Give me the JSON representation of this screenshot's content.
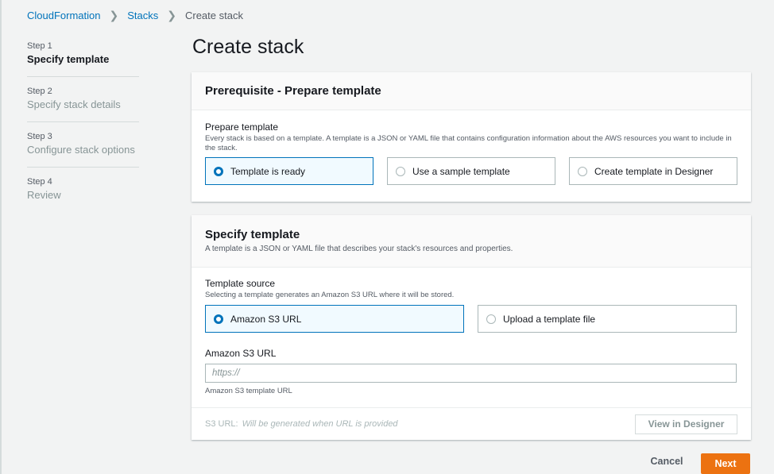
{
  "breadcrumb": {
    "items": [
      "CloudFormation",
      "Stacks"
    ],
    "current": "Create stack"
  },
  "steps": [
    {
      "num": "Step 1",
      "title": "Specify template"
    },
    {
      "num": "Step 2",
      "title": "Specify stack details"
    },
    {
      "num": "Step 3",
      "title": "Configure stack options"
    },
    {
      "num": "Step 4",
      "title": "Review"
    }
  ],
  "page_title": "Create stack",
  "prerequisite": {
    "title": "Prerequisite - Prepare template",
    "field_label": "Prepare template",
    "field_desc": "Every stack is based on a template. A template is a JSON or YAML file that contains configuration information about the AWS resources you want to include in the stack.",
    "options": [
      "Template is ready",
      "Use a sample template",
      "Create template in Designer"
    ],
    "selected": "Template is ready"
  },
  "specify": {
    "title": "Specify template",
    "desc": "A template is a JSON or YAML file that describes your stack's resources and properties.",
    "source_label": "Template source",
    "source_desc": "Selecting a template generates an Amazon S3 URL where it will be stored.",
    "options": [
      "Amazon S3 URL",
      "Upload a template file"
    ],
    "selected": "Amazon S3 URL",
    "s3_label": "Amazon S3 URL",
    "s3_placeholder": "https://",
    "s3_hint": "Amazon S3 template URL",
    "s3url_label": "S3 URL:",
    "s3url_value": "Will be generated when URL is provided",
    "designer_button": "View in Designer"
  },
  "actions": {
    "cancel": "Cancel",
    "next": "Next"
  },
  "colors": {
    "link": "#0073bb",
    "primary": "#ec7211",
    "selected_tile_bg": "#f1faff"
  }
}
